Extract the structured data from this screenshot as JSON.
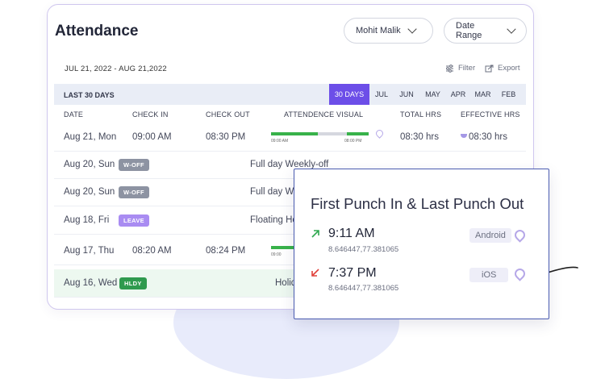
{
  "title": "Attendance",
  "user_dropdown": "Mohit Malik",
  "range_dropdown": "Date Range",
  "date_range": "JUL 21, 2022 - AUG 21,2022",
  "filter_label": "Filter",
  "export_label": "Export",
  "period_label": "LAST 30 DAYS",
  "periods": [
    "30 DAYS",
    "JUL",
    "JUN",
    "MAY",
    "APR",
    "MAR",
    "FEB"
  ],
  "active_period": "30 DAYS",
  "columns": [
    "DATE",
    "CHECK IN",
    "CHECK OUT",
    "ATTENDENCE VISUAL",
    "TOTAL HRS",
    "EFFECTIVE HRS"
  ],
  "rows": [
    {
      "date": "Aug 21, Mon",
      "check_in": "09:00 AM",
      "check_out": "08:30 PM",
      "total": "08:30 hrs",
      "effective": "08:30 hrs",
      "tick_start": "09:00 AM",
      "tick_end": "08:00 PM"
    },
    {
      "date": "Aug 20, Sun",
      "badge": "W-OFF",
      "note": "Full day Weekly-off"
    },
    {
      "date": "Aug 20, Sun",
      "badge": "W-OFF",
      "note": "Full day We"
    },
    {
      "date": "Aug 18, Fri",
      "badge": "LEAVE",
      "note": "Floating Ho"
    },
    {
      "date": "Aug 17, Thu",
      "check_in": "08:20 AM",
      "check_out": "08:24 PM",
      "tick_start": "09:00"
    },
    {
      "date": "Aug 16, Wed",
      "badge": "HLDY",
      "note": "Holid"
    }
  ],
  "popup": {
    "title": "First Punch In & Last Punch Out",
    "punch_in": {
      "time": "9:11 AM",
      "coords": "8.646447,77.381065",
      "device": "Android"
    },
    "punch_out": {
      "time": "7:37 PM",
      "coords": "8.646447,77.381065",
      "device": "iOS"
    }
  },
  "colors": {
    "accent": "#6c4ee8",
    "present_bar": "#38b24a",
    "holiday_row": "#edf8f0",
    "punch_in_arrow": "#2fa84f",
    "punch_out_arrow": "#e0403a"
  }
}
